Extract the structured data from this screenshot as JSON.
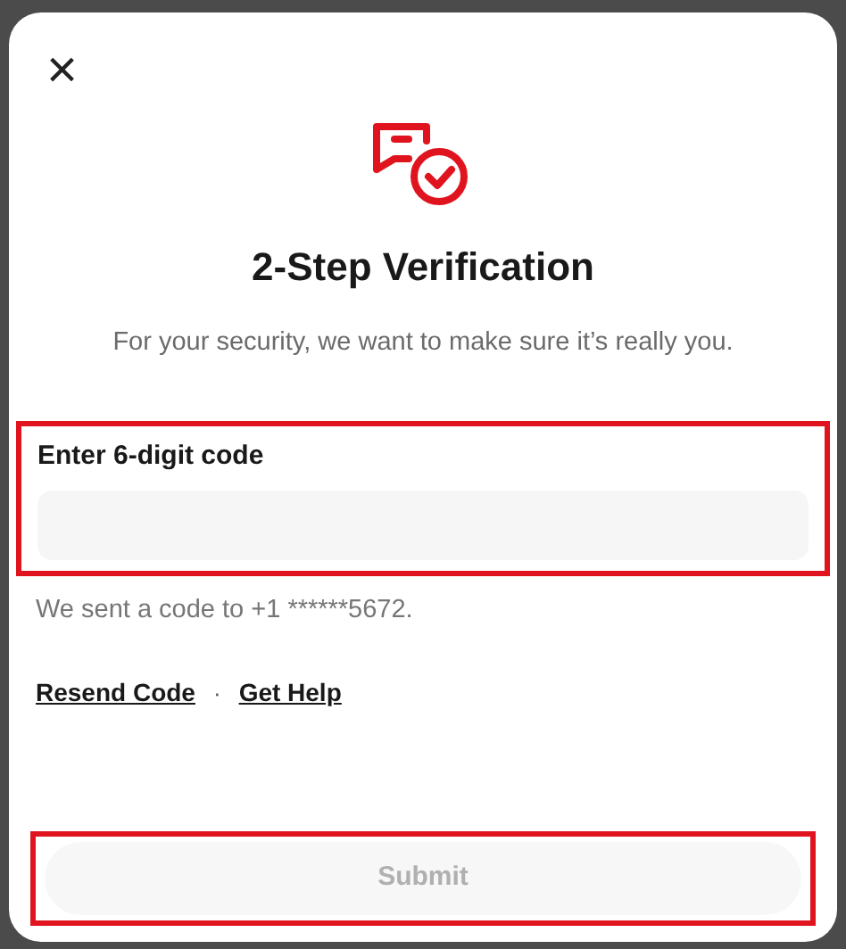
{
  "dialog": {
    "close_label": "×",
    "title": "2-Step Verification",
    "subtitle": "For your security, we want to make sure it’s really you.",
    "code_field": {
      "label": "Enter 6-digit code",
      "highlighted": true
    },
    "sent_note": "We sent a code to +1 ******5672.",
    "links": [
      {
        "label": "Resend Code"
      },
      {
        "label": "Get Help"
      }
    ],
    "link_separator": "·",
    "submit": {
      "label": "Submit",
      "disabled": true,
      "highlighted": true
    }
  }
}
